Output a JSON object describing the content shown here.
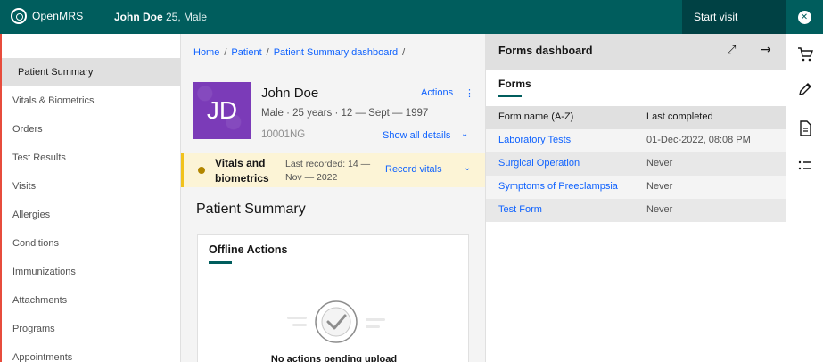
{
  "topbar": {
    "logo_text": "OpenMRS",
    "patient_name": "John Doe",
    "patient_meta": "25, Male",
    "start_visit": "Start visit"
  },
  "nav": {
    "items": [
      {
        "label": "Patient Summary",
        "active": true
      },
      {
        "label": "Vitals & Biometrics"
      },
      {
        "label": "Orders"
      },
      {
        "label": "Test Results"
      },
      {
        "label": "Visits"
      },
      {
        "label": "Allergies"
      },
      {
        "label": "Conditions"
      },
      {
        "label": "Immunizations"
      },
      {
        "label": "Attachments"
      },
      {
        "label": "Programs"
      },
      {
        "label": "Appointments"
      }
    ]
  },
  "breadcrumb": {
    "home": "Home",
    "patient": "Patient",
    "dashboard": "Patient Summary dashboard",
    "sep": "/"
  },
  "banner": {
    "initials": "JD",
    "name": "John Doe",
    "demographics": "Male · 25 years · 12 — Sept — 1997",
    "identifier": "10001NG",
    "actions": "Actions",
    "show_details": "Show all details"
  },
  "vitals": {
    "title": "Vitals and biometrics",
    "last_recorded": "Last recorded: 14 — Nov — 2022",
    "record": "Record vitals"
  },
  "summary": {
    "title": "Patient Summary",
    "card_title": "Offline Actions",
    "empty_text": "No actions pending upload"
  },
  "forms": {
    "panel_title": "Forms dashboard",
    "tab": "Forms",
    "col_name": "Form name (A-Z)",
    "col_last": "Last completed",
    "rows": [
      {
        "name": "Laboratory Tests",
        "last": "01-Dec-2022, 08:08 PM"
      },
      {
        "name": "Surgical Operation",
        "last": "Never"
      },
      {
        "name": "Symptoms of Preeclampsia",
        "last": "Never"
      },
      {
        "name": "Test Form",
        "last": "Never"
      }
    ]
  },
  "colors": {
    "brand": "#005d5d",
    "link": "#0f62fe",
    "warning_bg": "#fcf4d6",
    "avatar": "#7b3bb8"
  },
  "icons": [
    "close-icon",
    "shopping-cart-icon",
    "pen-icon",
    "document-icon",
    "list-icon",
    "maximize-icon",
    "arrow-right-icon",
    "checkmark-icon",
    "warning-icon",
    "chevron-down-icon",
    "overflow-menu-icon"
  ]
}
